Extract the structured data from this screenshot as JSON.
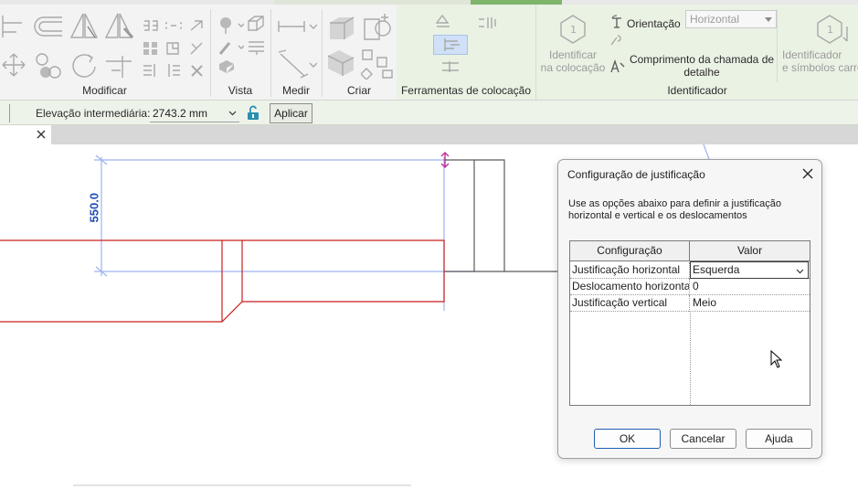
{
  "ribbon": {
    "panels": {
      "modificar": "Modificar",
      "vista": "Vista",
      "medir": "Medir",
      "criar": "Criar",
      "ferramentas": "Ferramentas de colocação",
      "identificador": "Identificador"
    },
    "identificador": {
      "tag_on_placement": "Identificar\nna colocação",
      "orientation_label": "Orientação",
      "orientation_value": "Horizontal",
      "leader_length": "Comprimento da chamada de\ndetalhe",
      "tags_symbols": "Identificador\ne símbolos carre"
    }
  },
  "options_bar": {
    "intermediate_elevation_label": "Elevação intermediária:",
    "intermediate_elevation_value": "2743.2 mm",
    "apply_label": "Aplicar"
  },
  "canvas": {
    "dimension_text": "550.0"
  },
  "dialog": {
    "title": "Configuração de justificação",
    "description": "Use as opções abaixo para definir a justificação horizontal e vertical e os deslocamentos",
    "table": {
      "headers": [
        "Configuração",
        "Valor"
      ],
      "rows": [
        {
          "setting": "Justificação horizontal",
          "value": "Esquerda"
        },
        {
          "setting": "Deslocamento horizontal",
          "value": "0"
        },
        {
          "setting": "Justificação vertical",
          "value": "Meio"
        }
      ]
    },
    "buttons": {
      "ok": "OK",
      "cancel": "Cancelar",
      "help": "Ajuda"
    }
  },
  "colors": {
    "contextual_tab_bg": "#eaf2e4",
    "selected_tab_accent": "#7fb46b",
    "dimension_blue": "#1f4fb5",
    "element_red": "#cc1f1f",
    "selection_blue": "#9db4ef",
    "grip_magenta": "#c0309a",
    "lock_teal": "#2b8fb0"
  }
}
